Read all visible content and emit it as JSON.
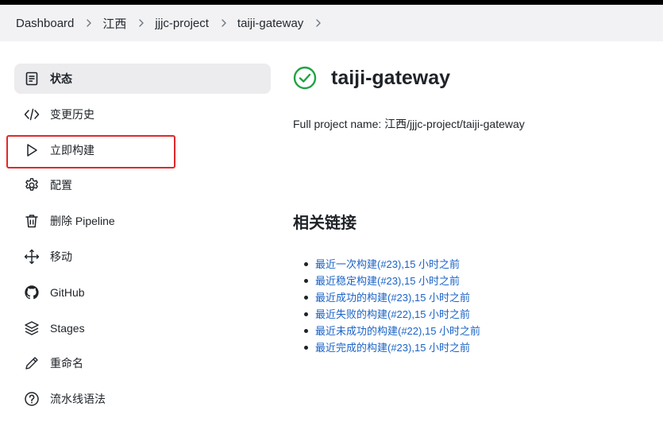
{
  "breadcrumb": {
    "items": [
      "Dashboard",
      "江西",
      "jjjc-project",
      "taiji-gateway"
    ]
  },
  "sidebar": {
    "items": [
      {
        "label": "状态",
        "icon": "document-icon"
      },
      {
        "label": "变更历史",
        "icon": "code-icon"
      },
      {
        "label": "立即构建",
        "icon": "play-icon"
      },
      {
        "label": "配置",
        "icon": "gear-icon"
      },
      {
        "label": "删除 Pipeline",
        "icon": "trash-icon"
      },
      {
        "label": "移动",
        "icon": "move-icon"
      },
      {
        "label": "GitHub",
        "icon": "github-icon"
      },
      {
        "label": "Stages",
        "icon": "layers-icon"
      },
      {
        "label": "重命名",
        "icon": "pencil-icon"
      },
      {
        "label": "流水线语法",
        "icon": "help-icon"
      }
    ]
  },
  "main": {
    "status_icon": "check-circle-icon",
    "status_color": "#1ea446",
    "title": "taiji-gateway",
    "full_name": "Full project name: 江西/jjjc-project/taiji-gateway",
    "section_title": "相关链接",
    "links": [
      "最近一次构建(#23),15 小时之前",
      "最近稳定构建(#23),15 小时之前",
      "最近成功的构建(#23),15 小时之前",
      "最近失败的构建(#22),15 小时之前",
      "最近未成功的构建(#22),15 小时之前",
      "最近完成的构建(#23),15 小时之前"
    ]
  },
  "colors": {
    "link": "#1b63c7",
    "highlight_border": "#e0282a",
    "active_bg": "#ececee"
  }
}
